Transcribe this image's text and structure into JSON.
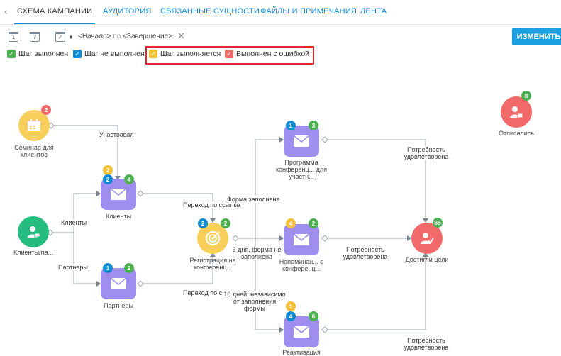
{
  "tabs": {
    "items": [
      {
        "label": "СХЕМА КАМПАНИИ"
      },
      {
        "label": "АУДИТОРИЯ"
      },
      {
        "label": "СВЯЗАННЫЕ СУЩНОСТИ"
      },
      {
        "label": "ФАЙЛЫ И ПРИМЕЧАНИЯ"
      },
      {
        "label": "ЛЕНТА"
      }
    ],
    "active_index": 0
  },
  "toolbar": {
    "cal1": "1",
    "cal2": "7",
    "period_start": "<Начало>",
    "period_by": "по",
    "period_end": "<Завершение>",
    "edit_label": "ИЗМЕНИТЬ"
  },
  "legend": {
    "items": [
      {
        "label": "Шаг выполнен",
        "color": "#4cb050"
      },
      {
        "label": "Шаг не выполнен",
        "color": "#0e8bd6"
      },
      {
        "label": "Шаг выполняется",
        "color": "#f4c034"
      },
      {
        "label": "Выполнен с ошибкой",
        "color": "#f26a6a"
      }
    ]
  },
  "nodes": {
    "seminar": {
      "label": "Семинар для клиентов",
      "badge_red": "2"
    },
    "clients_pa": {
      "label": "Клиенты/па..."
    },
    "clients": {
      "label": "Клиенты",
      "badge_yellow": "2",
      "badge_blue": "2",
      "badge_green": "4"
    },
    "partners": {
      "label": "Партнеры",
      "badge_blue": "1",
      "badge_green": "2"
    },
    "registration": {
      "label": "Регистрация на конференц...",
      "badge_blue": "2",
      "badge_green": "2"
    },
    "program": {
      "label": "Программа конференц... для участн...",
      "badge_blue": "1",
      "badge_green": "3"
    },
    "reminder": {
      "label": "Напоминан... о конференц...",
      "badge_yellow": "4",
      "badge_green": "2"
    },
    "reactivation": {
      "label": "Реактивация",
      "badge_yellow": "1",
      "badge_blue": "4",
      "badge_green": "6"
    },
    "goal": {
      "label": "Достигли цели",
      "badge_green": "85"
    },
    "unsubscribed": {
      "label": "Отписались",
      "badge_green": "8"
    }
  },
  "edges": {
    "participated": "Участвовал",
    "clients": "Клиенты",
    "partners": "Партнеры",
    "link1": "Переход по ссылке",
    "link2": "Переход по ссылке",
    "form_filled": "Форма заполнена",
    "three_days": "3 дня, форма не заполнена",
    "ten_days": "10 дней, независимо от заполнения формы",
    "need1": "Потребность удовлетворена",
    "need2": "Потребность удовлетворена",
    "need3": "Потребность удовлетворена"
  },
  "colors": {
    "accent": "#1ba1e2",
    "email_node": "#9f8df0",
    "event_node": "#f7cf5a",
    "audience_node": "#26bc7f",
    "goal_node": "#f26a6a",
    "highlight_border": "#e2272f"
  }
}
